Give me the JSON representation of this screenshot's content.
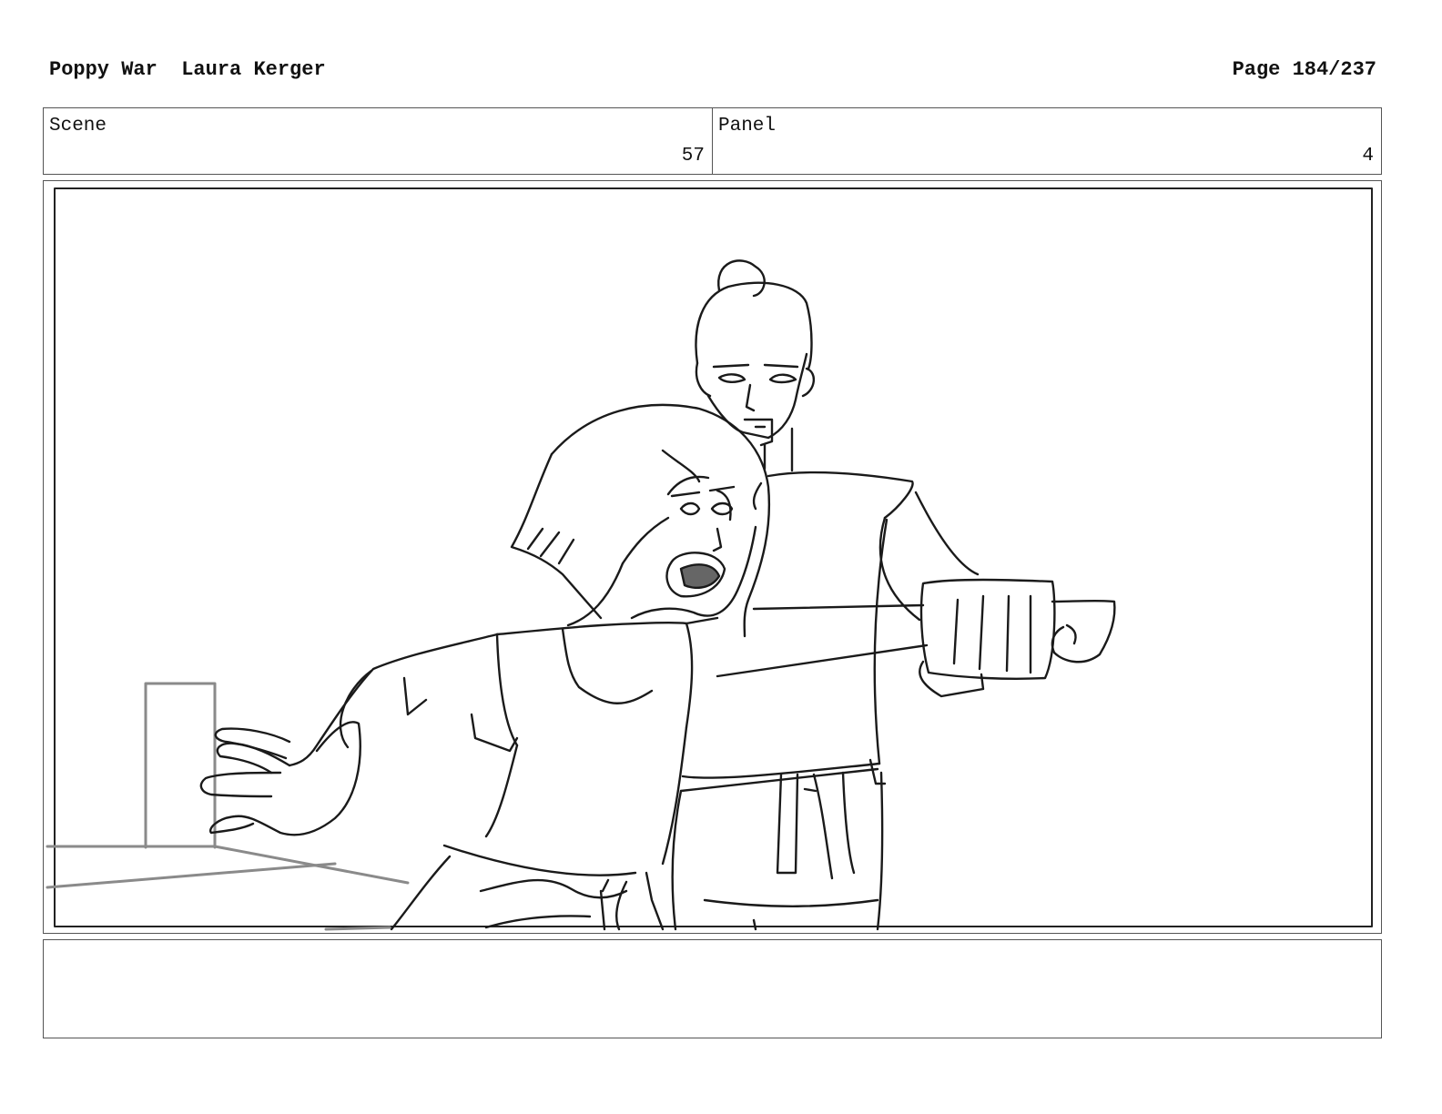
{
  "header": {
    "project": "Poppy War",
    "author": "Laura Kerger",
    "page": "Page 184/237"
  },
  "info": {
    "scene_label": "Scene",
    "scene_value": "57",
    "panel_label": "Panel",
    "panel_value": "4"
  },
  "artwork": {
    "icon": "storyboard-sketch-icon",
    "colors": {
      "line": "#1a1a1a",
      "background_line": "#8a8a8a",
      "mouth": "#666666"
    }
  },
  "notes": {
    "text": ""
  }
}
